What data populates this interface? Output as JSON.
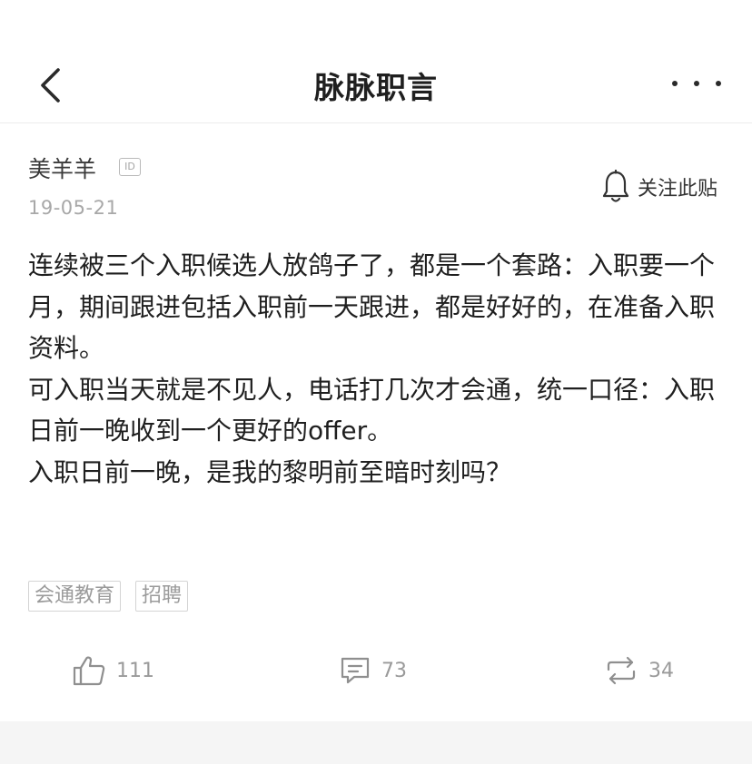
{
  "header": {
    "title": "脉脉职言"
  },
  "post": {
    "author": "美羊羊",
    "id_badge": "ID",
    "date": "19-05-21",
    "follow_label": "关注此贴",
    "content_lines": [
      "连续被三个入职候选人放鸽子了，都是一个套路：入职要一个月，期间跟进包括入职前一天跟进，都是好好的，在准备入职资料。",
      "可入职当天就是不见人，电话打几次才会通，统一口径：入职日前一晚收到一个更好的offer。",
      "入职日前一晚，是我的黎明前至暗时刻吗？"
    ],
    "tags": [
      "会通教育",
      "招聘"
    ]
  },
  "actions": {
    "likes": "111",
    "comments": "73",
    "shares": "34"
  },
  "icons": {
    "back": "chevron-left-icon",
    "more": "more-dots-icon",
    "follow": "bell-icon",
    "like": "thumbs-up-icon",
    "comment": "comment-icon",
    "share": "repost-icon"
  }
}
